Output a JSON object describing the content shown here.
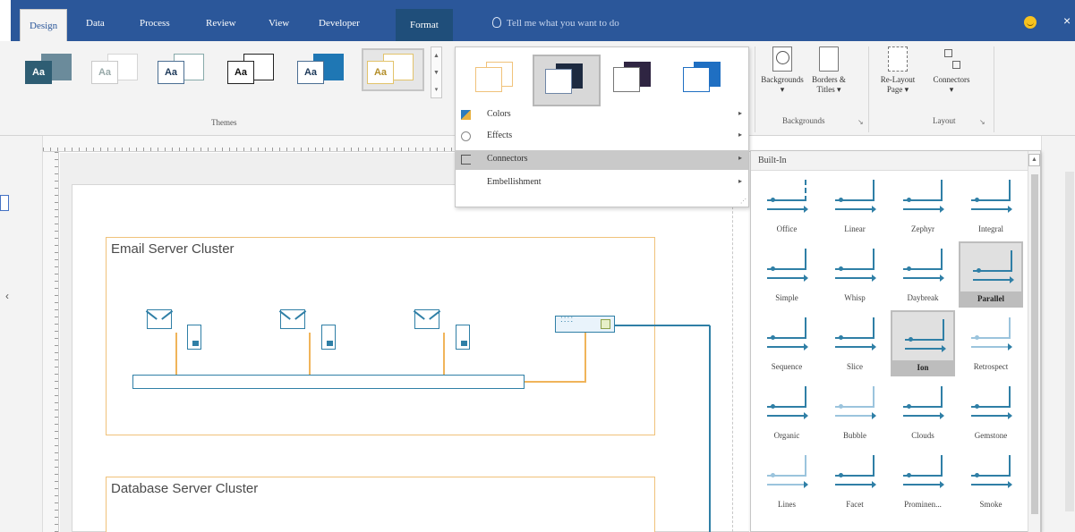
{
  "tabs": [
    {
      "label": "Design",
      "active": true
    },
    {
      "label": "Data"
    },
    {
      "label": "Process"
    },
    {
      "label": "Review"
    },
    {
      "label": "View"
    },
    {
      "label": "Developer"
    },
    {
      "label": "Format"
    }
  ],
  "tell_me": {
    "placeholder": "Tell me what you want to do",
    "icon": "lightbulb-icon"
  },
  "account": {
    "icon": "smiley-feedback-icon"
  },
  "ribbon": {
    "themes_group_label": "Themes",
    "theme_thumb_text": "Aa",
    "backgrounds_group": {
      "label": "Backgrounds",
      "buttons": [
        {
          "label": "Backgrounds",
          "sub": "▾",
          "icon": "backgrounds-icon"
        },
        {
          "label": "Borders &",
          "sub": "Titles ▾",
          "icon": "borders-titles-icon"
        }
      ]
    },
    "layout_group": {
      "label": "Layout",
      "buttons": [
        {
          "label": "Re-Layout",
          "sub": "Page ▾",
          "icon": "relayout-page-icon"
        },
        {
          "label": "Connectors",
          "sub": "▾",
          "icon": "connectors-icon"
        }
      ]
    },
    "launcher_glyph": "↘"
  },
  "variants_menu": {
    "items": [
      {
        "label": "Colors",
        "icon": "colors-icon",
        "arrow": "▸"
      },
      {
        "label": "Effects",
        "icon": "effects-icon",
        "arrow": "▸"
      },
      {
        "label": "Connectors",
        "icon": "connectors-icon",
        "arrow": "▸",
        "highlighted": true
      },
      {
        "label": "Embellishment",
        "icon": "embellishment-icon",
        "arrow": "▸"
      }
    ]
  },
  "connectors_gallery": {
    "header": "Built-In",
    "items": [
      {
        "label": "Office"
      },
      {
        "label": "Linear"
      },
      {
        "label": "Zephyr"
      },
      {
        "label": "Integral"
      },
      {
        "label": "Simple"
      },
      {
        "label": "Whisp"
      },
      {
        "label": "Daybreak"
      },
      {
        "label": "Parallel",
        "selected": true
      },
      {
        "label": "Sequence"
      },
      {
        "label": "Slice"
      },
      {
        "label": "Ion",
        "selected": true
      },
      {
        "label": "Retrospect"
      },
      {
        "label": "Organic"
      },
      {
        "label": "Bubble"
      },
      {
        "label": "Clouds"
      },
      {
        "label": "Gemstone"
      },
      {
        "label": "Lines"
      },
      {
        "label": "Facet"
      },
      {
        "label": "Prominen..."
      },
      {
        "label": "Smoke"
      }
    ]
  },
  "diagram": {
    "clusters": [
      {
        "title": "Email Server Cluster"
      },
      {
        "title": "Database Server Cluster"
      }
    ]
  },
  "colors": {
    "tab_bar": "#2b579a",
    "connector_blue": "#2f7fa6",
    "cluster_border": "#f0c27a"
  }
}
